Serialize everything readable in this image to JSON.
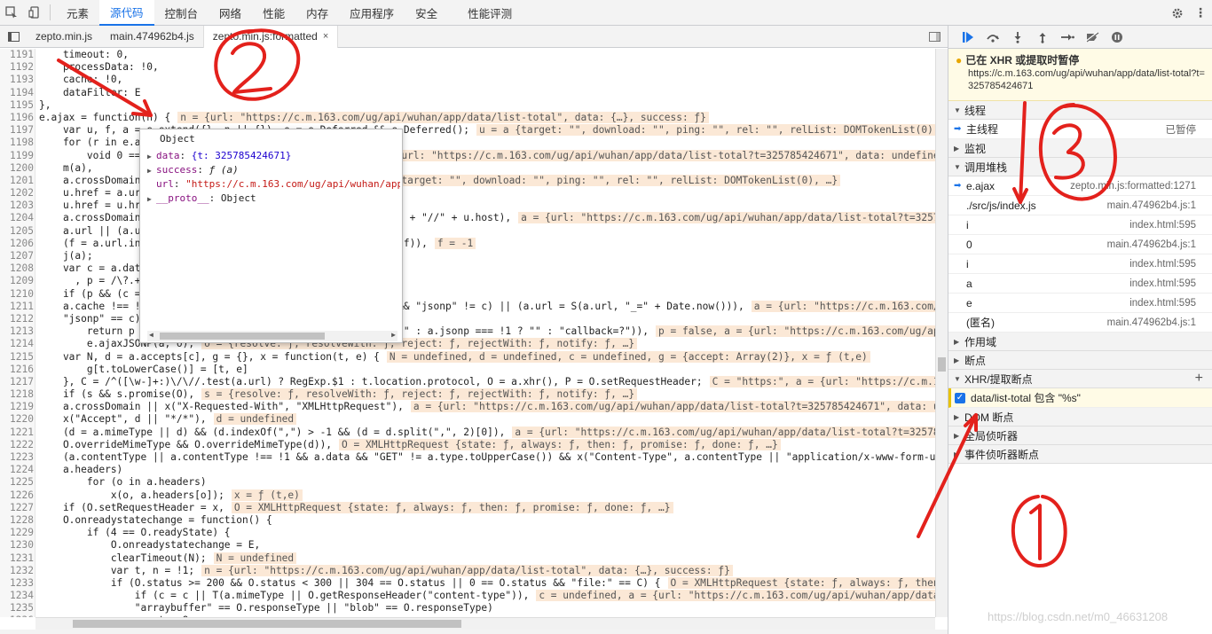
{
  "topbar": {
    "tabs": [
      "元素",
      "源代码",
      "控制台",
      "网络",
      "性能",
      "内存",
      "应用程序",
      "安全",
      "性能评测"
    ],
    "active_tab": "源代码"
  },
  "filetabs": [
    {
      "label": "zepto.min.js",
      "active": false
    },
    {
      "label": "main.474962b4.js",
      "active": false
    },
    {
      "label": "zepto.min.js:formatted",
      "active": true,
      "close": "×"
    }
  ],
  "code": [
    {
      "n": "1191",
      "t": "    timeout: 0,"
    },
    {
      "n": "1192",
      "t": "    processData: !0,"
    },
    {
      "n": "1193",
      "t": "    cache: !0,"
    },
    {
      "n": "1194",
      "t": "    dataFilter: E"
    },
    {
      "n": "1195",
      "t": "},"
    },
    {
      "n": "1196",
      "t": "e.ajax = function(n) {",
      "e": "n = {url: \"https://c.m.163.com/ug/api/wuhan/app/data/list-total\", data: {…}, success: ƒ}"
    },
    {
      "n": "1197",
      "t": "    var u, f, a = e.extend({}, n || {}), o = e.Deferred && e.Deferred();",
      "e": "u = a {target: \"\", download: \"\", ping: \"\", rel: \"\", relList: DOMTokenList(0), …"
    },
    {
      "n": "1198",
      "t": "    for (r in e.ajaxSettings)"
    },
    {
      "n": "1199",
      "t": "        void 0 === a[r] && (a[r] = e.ajaxSettings[r]);",
      "e": "a = {url: \"https://c.m.163.com/ug/api/wuhan/app/data/list-total?t=325785424671\", data: undefined"
    },
    {
      "n": "1200",
      "t": "    m(a),"
    },
    {
      "n": "1201",
      "t": "    a.crossDomain || (u = document.createElement(\"a\"),",
      "e": "f = {target: \"\", download: \"\", ping: \"\", rel: \"\", relList: DOMTokenList(0), …}"
    },
    {
      "n": "1202",
      "t": "    u.href = a.url,"
    },
    {
      "n": "1203",
      "t": "    u.href = u.href,"
    },
    {
      "n": "1204",
      "t": "    a.crossDomain = T.protocol + \"//\" + T.host !== u.protocol + \"//\" + u.host),",
      "e": "a = {url: \"https://c.m.163.com/ug/api/wuhan/app/data/list-total?t=325785"
    },
    {
      "n": "1205",
      "t": "    a.url || (a.url = window.location.toString()),"
    },
    {
      "n": "1206",
      "t": "    (f = a.url.indexOf(\"#\")) > -1 && (a.url = a.url.slice(0, f)),",
      "e": "f = -1"
    },
    {
      "n": "1207",
      "t": "    j(a);"
    },
    {
      "n": "1208",
      "t": "    var c = a.dataType"
    },
    {
      "n": "1209",
      "t": "      , p = /\\?.+=\\?/.test(a.url);"
    },
    {
      "n": "1210",
      "t": "    if (p && (c = \"jsonp\"),"
    },
    {
      "n": "1211",
      "t": "    a.cache !== !1 && (n && n.cache === !0 || \"script\" != c && \"jsonp\" != c) || (a.url = S(a.url, \"_=\" + Date.now())),",
      "e": "a = {url: \"https://c.m.163.com/u"
    },
    {
      "n": "1212",
      "t": "    \"jsonp\" == c)"
    },
    {
      "n": "1213",
      "t": "        return p || (a.url = S(a.url, a.jsonp ? a.jsonp + \"=?\" : a.jsonp === !1 ? \"\" : \"callback=?\")),",
      "e": "p = false, a = {url: \"https://c.m.163.com/ug/api"
    },
    {
      "n": "1214",
      "t": "        e.ajaxJSONP(a, o);",
      "e": "o = {resolve: ƒ, resolveWith: ƒ, reject: ƒ, rejectWith: ƒ, notify: ƒ, …}"
    },
    {
      "n": "1215",
      "t": "    var N, d = a.accepts[c], g = {}, x = function(t, e) {",
      "e": "N = undefined, d = undefined, c = undefined, g = {accept: Array(2)}, x = ƒ (t,e)"
    },
    {
      "n": "1216",
      "t": "        g[t.toLowerCase()] = [t, e]"
    },
    {
      "n": "1217",
      "t": "    }, C = /^([\\w-]+:)\\/\\//.test(a.url) ? RegExp.$1 : t.location.protocol, O = a.xhr(), P = O.setRequestHeader;",
      "e": "C = \"https:\", a = {url: \"https://c.m.16"
    },
    {
      "n": "1218",
      "t": "    if (s && s.promise(O),",
      "e": "s = {resolve: ƒ, resolveWith: ƒ, reject: ƒ, rejectWith: ƒ, notify: ƒ, …}"
    },
    {
      "n": "1219",
      "t": "    a.crossDomain || x(\"X-Requested-With\", \"XMLHttpRequest\"),",
      "e": "a = {url: \"https://c.m.163.com/ug/api/wuhan/app/data/list-total?t=325785424671\", data: und"
    },
    {
      "n": "1220",
      "t": "    x(\"Accept\", d || \"*/*\"),",
      "e": "d = undefined"
    },
    {
      "n": "1221",
      "t": "    (d = a.mimeType || d) && (d.indexOf(\",\") > -1 && (d = d.split(\",\", 2)[0]),",
      "e": "a = {url: \"https://c.m.163.com/ug/api/wuhan/app/data/list-total?t=325785"
    },
    {
      "n": "1222",
      "t": "    O.overrideMimeType && O.overrideMimeType(d)),",
      "e": "O = XMLHttpRequest {state: ƒ, always: ƒ, then: ƒ, promise: ƒ, done: ƒ, …}"
    },
    {
      "n": "1223",
      "t": "    (a.contentType || a.contentType !== !1 && a.data && \"GET\" != a.type.toUpperCase()) && x(\"Content-Type\", a.contentType || \"application/x-www-form-urle"
    },
    {
      "n": "1224",
      "t": "    a.headers)"
    },
    {
      "n": "1225",
      "t": "        for (o in a.headers)"
    },
    {
      "n": "1226",
      "t": "            x(o, a.headers[o]);",
      "e": "x = ƒ (t,e)"
    },
    {
      "n": "1227",
      "t": "    if (O.setRequestHeader = x,",
      "e": "O = XMLHttpRequest {state: ƒ, always: ƒ, then: ƒ, promise: ƒ, done: ƒ, …}"
    },
    {
      "n": "1228",
      "t": "    O.onreadystatechange = function() {"
    },
    {
      "n": "1229",
      "t": "        if (4 == O.readyState) {"
    },
    {
      "n": "1230",
      "t": "            O.onreadystatechange = E,"
    },
    {
      "n": "1231",
      "t": "            clearTimeout(N);",
      "e": "N = undefined"
    },
    {
      "n": "1232",
      "t": "            var t, n = !1;",
      "e": "n = {url: \"https://c.m.163.com/ug/api/wuhan/app/data/list-total\", data: {…}, success: ƒ}"
    },
    {
      "n": "1233",
      "t": "            if (O.status >= 200 && O.status < 300 || 304 == O.status || 0 == O.status && \"file:\" == C) {",
      "e": "O = XMLHttpRequest {state: ƒ, always: ƒ, then:"
    },
    {
      "n": "1234",
      "t": "                if (c = c || T(a.mimeType || O.getResponseHeader(\"content-type\")),",
      "e": "c = undefined, a = {url: \"https://c.m.163.com/ug/api/wuhan/app/data/"
    },
    {
      "n": "1235",
      "t": "                \"arraybuffer\" == O.responseType || \"blob\" == O.responseType)"
    },
    {
      "n": "1236",
      "t": "                    t = O.response;"
    }
  ],
  "popover": {
    "title": "Object",
    "rows": [
      {
        "key": "data",
        "sep": ": ",
        "val": "{t: 325785424671}",
        "kind": "num",
        "expand": true
      },
      {
        "key": "success",
        "sep": ": ",
        "val": "ƒ (a)",
        "kind": "fn",
        "expand": true
      },
      {
        "key": "url",
        "sep": ": ",
        "val": "\"https://c.m.163.com/ug/api/wuhan/app/data/list-total\"",
        "kind": "str",
        "expand": false
      },
      {
        "key": "__proto__",
        "sep": ": ",
        "val": "Object",
        "kind": "plain",
        "expand": true
      }
    ]
  },
  "debugger": {
    "pause_title": "已在 XHR 或提取时暂停",
    "pause_url": "https://c.m.163.com/ug/api/wuhan/app/data/list-total?t=325785424671",
    "sections": {
      "threads": "线程",
      "watch": "监视",
      "callstack": "调用堆栈",
      "scope": "作用域",
      "breakpoints": "断点",
      "xhr": "XHR/提取断点",
      "dom": "DOM 断点",
      "global": "全局侦听器",
      "event": "事件侦听器断点"
    },
    "main_thread": {
      "label": "主线程",
      "status": "已暂停"
    },
    "callstack": [
      {
        "fn": "e.ajax",
        "loc": "zepto.min.js:formatted:1271",
        "current": true
      },
      {
        "fn": "./src/js/index.js",
        "loc": "main.474962b4.js:1"
      },
      {
        "fn": "i",
        "loc": "index.html:595"
      },
      {
        "fn": "0",
        "loc": "main.474962b4.js:1"
      },
      {
        "fn": "i",
        "loc": "index.html:595"
      },
      {
        "fn": "a",
        "loc": "index.html:595"
      },
      {
        "fn": "e",
        "loc": "index.html:595"
      },
      {
        "fn": "(匿名)",
        "loc": "main.474962b4.js:1"
      }
    ],
    "xhr_breakpoint": "data/list-total 包含 \"%s\"",
    "xhr_add": "+"
  },
  "watermark": "https://blog.csdn.net/m0_46631208",
  "colors": {
    "accent": "#1a73e8",
    "eval_bg": "#fbe8d6",
    "annotation": "#e3211c"
  }
}
